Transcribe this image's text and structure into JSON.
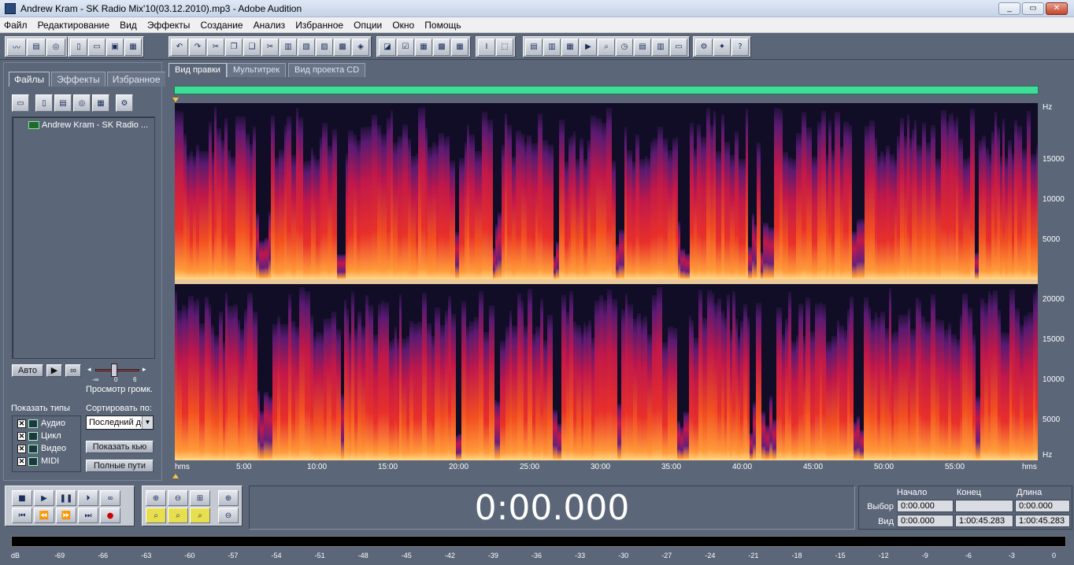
{
  "window": {
    "title": "Andrew Kram - SK Radio Mix'10(03.12.2010).mp3 - Adobe Audition",
    "min": "_",
    "max": "▭",
    "close": "✕"
  },
  "menu": [
    "Файл",
    "Редактирование",
    "Вид",
    "Эффекты",
    "Создание",
    "Анализ",
    "Избранное",
    "Опции",
    "Окно",
    "Помощь"
  ],
  "left": {
    "tabs": [
      "Файлы",
      "Эффекты",
      "Избранное"
    ],
    "file": "Andrew Kram - SK Radio ...",
    "auto": "Авто",
    "preview_volume": "Просмотр громк.",
    "vol_marks": [
      "-∞",
      "0",
      "6"
    ],
    "show_types": "Показать типы",
    "types": [
      "Аудио",
      "Цикл",
      "Видео",
      "MIDI"
    ],
    "sort_by": "Сортировать по:",
    "sort_value": "Последний до",
    "show_cue": "Показать кью",
    "full_paths": "Полные пути"
  },
  "view_tabs": [
    "Вид правки",
    "Мультитрек",
    "Вид проекта CD"
  ],
  "freq_labels_top": [
    "Hz",
    "15000",
    "10000",
    "5000"
  ],
  "freq_labels_bot": [
    "20000",
    "15000",
    "10000",
    "5000",
    "Hz"
  ],
  "time_labels": [
    "hms",
    "5:00",
    "10:00",
    "15:00",
    "20:00",
    "25:00",
    "30:00",
    "35:00",
    "40:00",
    "45:00",
    "50:00",
    "55:00",
    "hms"
  ],
  "time_display": "0:00.000",
  "selection": {
    "headers": [
      "Начало",
      "Конец",
      "Длина"
    ],
    "sel_label": "Выбор",
    "view_label": "Вид",
    "sel_begin": "0:00.000",
    "sel_end": "",
    "sel_len": "0:00.000",
    "view_begin": "0:00.000",
    "view_end": "1:00:45.283",
    "view_len": "1:00:45.283"
  },
  "meter_labels": [
    "dB",
    "-69",
    "-66",
    "-63",
    "-60",
    "-57",
    "-54",
    "-51",
    "-48",
    "-45",
    "-42",
    "-39",
    "-36",
    "-33",
    "-30",
    "-27",
    "-24",
    "-21",
    "-18",
    "-15",
    "-12",
    "-9",
    "-6",
    "-3",
    "0"
  ]
}
